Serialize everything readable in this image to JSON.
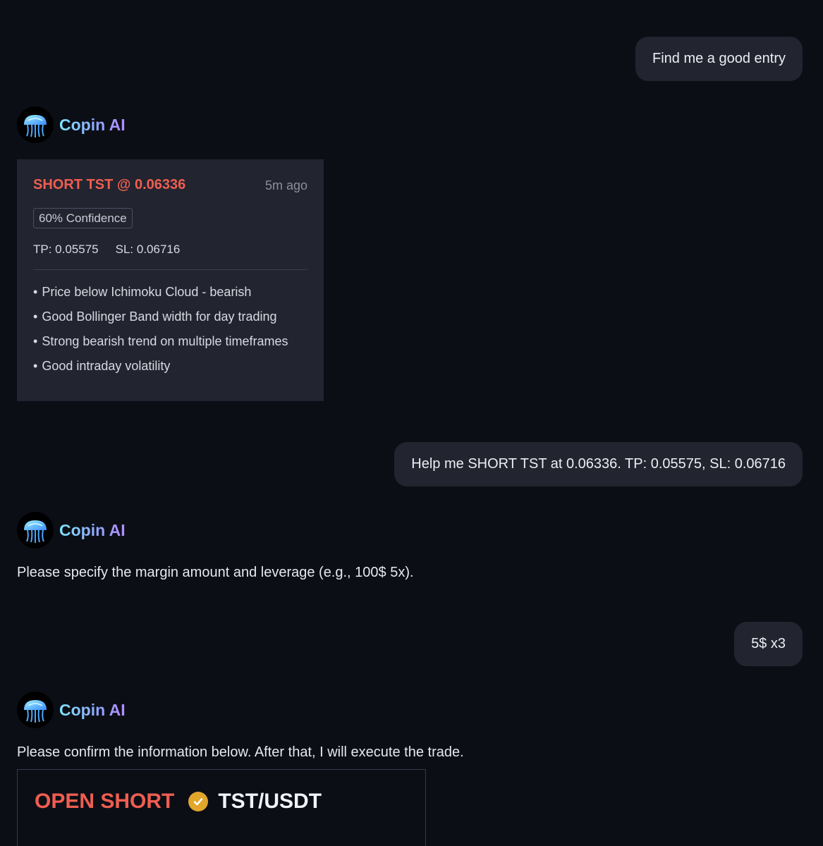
{
  "messages": {
    "user_1": "Find me a good entry",
    "ai_name": "Copin AI",
    "signal": {
      "title": "SHORT TST @ 0.06336",
      "time": "5m ago",
      "confidence": "60% Confidence",
      "tp": "TP: 0.05575",
      "sl": "SL: 0.06716",
      "reasons": [
        "Price below Ichimoku Cloud - bearish",
        "Good Bollinger Band width for day trading",
        "Strong bearish trend on multiple timeframes",
        "Good intraday volatility"
      ]
    },
    "user_2": "Help me SHORT TST at 0.06336. TP: 0.05575, SL: 0.06716",
    "ai_reply_2": "Please specify the margin amount and leverage (e.g., 100$ 5x).",
    "user_3": "5$ x3",
    "ai_reply_3": "Please confirm the information below. After that, I will execute the trade.",
    "confirm": {
      "action": "OPEN SHORT",
      "pair": "TST/USDT"
    }
  },
  "colors": {
    "background": "#0c0e16",
    "bubble": "#22242f",
    "short_red": "#ef5e50",
    "check_gold": "#e2a62b"
  }
}
